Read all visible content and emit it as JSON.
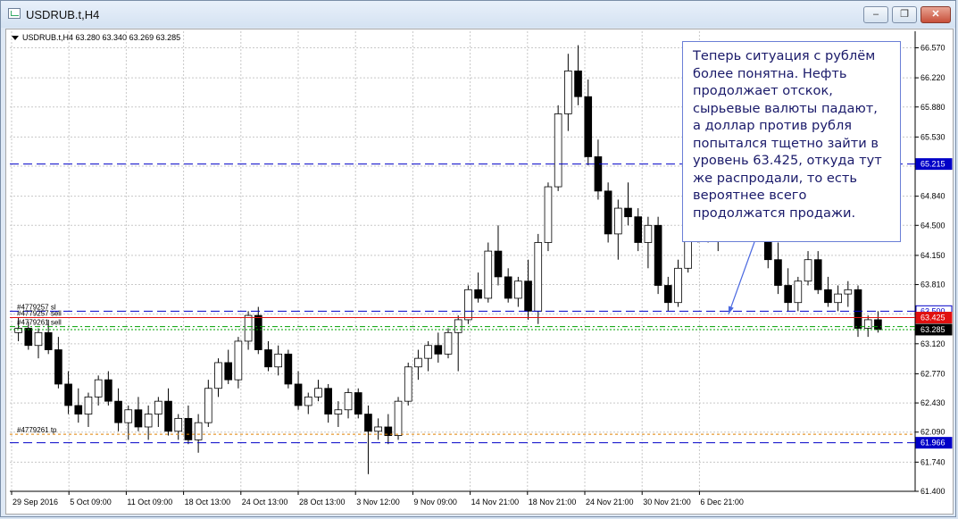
{
  "window": {
    "title": "USDRUB.t,H4",
    "minimize": "‒",
    "maximize": "❐",
    "close": "✕"
  },
  "chart_info": {
    "symbol_line": "USDRUB.t,H4  63.280 63.340 63.269 63.285"
  },
  "annotation": {
    "text": "Теперь ситуация с рублём\nболее понятна. Нефть\nпродолжает отскок,\nсырьевые валюты падают,\nа доллар против рубля\nпопытался тщетно зайти в\nуровень 63.425, откуда тут\nже распродали, то есть\nвероятнее всего\nпродолжатся продажи."
  },
  "colors": {
    "bull": "#ffffff",
    "bear": "#000000",
    "grid": "#c8c8c8",
    "blue_line": "#0000c8",
    "red_line": "#e01010",
    "green_line": "#00a000",
    "orange_line": "#e08000"
  },
  "chart_data": {
    "type": "candlestick",
    "title": "",
    "ylim": [
      61.4,
      66.7
    ],
    "y_ticks": [
      61.4,
      61.74,
      62.09,
      62.43,
      62.77,
      63.12,
      63.465,
      63.81,
      64.15,
      64.5,
      64.84,
      65.19,
      65.53,
      65.88,
      66.22,
      66.57
    ],
    "y_tick_labels": [
      "61.400",
      "61.740",
      "62.090",
      "62.430",
      "62.770",
      "63.120",
      "63.465",
      "63.810",
      "64.150",
      "64.500",
      "64.840",
      "65.190",
      "65.530",
      "65.880",
      "66.220",
      "66.570"
    ],
    "x_labels": [
      "29 Sep 2016",
      "5 Oct 09:00",
      "11 Oct 09:00",
      "18 Oct 13:00",
      "24 Oct 13:00",
      "28 Oct 13:00",
      "3 Nov 12:00",
      "9 Nov 09:00",
      "14 Nov 21:00",
      "18 Nov 21:00",
      "24 Nov 21:00",
      "30 Nov 21:00",
      "6 Dec 21:00"
    ],
    "current_price": 63.285,
    "price_labels": [
      {
        "value": 65.215,
        "text": "65.215",
        "color": "#0000c8",
        "style": "solid"
      },
      {
        "value": 63.5,
        "text": "63.500",
        "color": "#0000c8",
        "style": "outline"
      },
      {
        "value": 63.425,
        "text": "63.425",
        "color": "#e01010",
        "style": "solid"
      },
      {
        "value": 63.285,
        "text": "63.285",
        "color": "#000000",
        "style": "solid"
      },
      {
        "value": 61.966,
        "text": "61.966",
        "color": "#0000c8",
        "style": "solid"
      }
    ],
    "levels": [
      {
        "value": 65.215,
        "color": "#0000c8",
        "dash": "10,5",
        "label": ""
      },
      {
        "value": 63.5,
        "color": "#0000c8",
        "dash": "10,5",
        "label": "#4779257 sl"
      },
      {
        "value": 63.425,
        "color": "#e01010",
        "dash": "",
        "label": "#4779257 sell"
      },
      {
        "value": 63.32,
        "color": "#00a000",
        "dash": "6,3,2,3",
        "label": "#4779261 sell"
      },
      {
        "value": 63.285,
        "color": "#00a000",
        "dash": "2,2",
        "label": ""
      },
      {
        "value": 62.065,
        "color": "#e08000",
        "dash": "3,3",
        "label": "#4779261 tp"
      },
      {
        "value": 61.966,
        "color": "#0000c8",
        "dash": "10,5",
        "label": ""
      }
    ],
    "ohlc": [
      [
        63.25,
        63.42,
        63.15,
        63.3
      ],
      [
        63.3,
        63.38,
        63.05,
        63.1
      ],
      [
        63.1,
        63.3,
        62.95,
        63.25
      ],
      [
        63.25,
        63.4,
        63.0,
        63.05
      ],
      [
        63.05,
        63.2,
        62.6,
        62.65
      ],
      [
        62.65,
        62.8,
        62.3,
        62.4
      ],
      [
        62.4,
        62.6,
        62.2,
        62.3
      ],
      [
        62.3,
        62.55,
        62.15,
        62.5
      ],
      [
        62.5,
        62.75,
        62.4,
        62.7
      ],
      [
        62.7,
        62.8,
        62.4,
        62.45
      ],
      [
        62.45,
        62.6,
        62.1,
        62.2
      ],
      [
        62.2,
        62.4,
        62.0,
        62.35
      ],
      [
        62.35,
        62.5,
        62.1,
        62.15
      ],
      [
        62.15,
        62.4,
        62.0,
        62.3
      ],
      [
        62.3,
        62.5,
        62.15,
        62.45
      ],
      [
        62.45,
        62.6,
        62.05,
        62.1
      ],
      [
        62.1,
        62.3,
        62.0,
        62.25
      ],
      [
        62.25,
        62.4,
        61.95,
        62.0
      ],
      [
        62.0,
        62.3,
        61.85,
        62.2
      ],
      [
        62.2,
        62.7,
        62.15,
        62.6
      ],
      [
        62.6,
        62.95,
        62.5,
        62.9
      ],
      [
        62.9,
        63.05,
        62.65,
        62.7
      ],
      [
        62.7,
        63.2,
        62.6,
        63.15
      ],
      [
        63.15,
        63.5,
        63.05,
        63.45
      ],
      [
        63.45,
        63.55,
        63.0,
        63.05
      ],
      [
        63.05,
        63.15,
        62.8,
        62.85
      ],
      [
        62.85,
        63.1,
        62.75,
        63.0
      ],
      [
        63.0,
        63.05,
        62.6,
        62.65
      ],
      [
        62.65,
        62.8,
        62.35,
        62.4
      ],
      [
        62.4,
        62.55,
        62.3,
        62.5
      ],
      [
        62.5,
        62.7,
        62.45,
        62.6
      ],
      [
        62.6,
        62.65,
        62.2,
        62.3
      ],
      [
        62.3,
        62.45,
        62.15,
        62.35
      ],
      [
        62.35,
        62.6,
        62.25,
        62.55
      ],
      [
        62.55,
        62.6,
        62.25,
        62.3
      ],
      [
        62.3,
        62.4,
        61.6,
        62.1
      ],
      [
        62.1,
        62.25,
        62.0,
        62.15
      ],
      [
        62.15,
        62.3,
        61.95,
        62.05
      ],
      [
        62.05,
        62.5,
        62.0,
        62.45
      ],
      [
        62.45,
        62.9,
        62.4,
        62.85
      ],
      [
        62.85,
        63.05,
        62.7,
        62.95
      ],
      [
        62.95,
        63.15,
        62.8,
        63.1
      ],
      [
        63.1,
        63.25,
        62.9,
        63.0
      ],
      [
        63.0,
        63.3,
        62.95,
        63.25
      ],
      [
        63.25,
        63.45,
        62.8,
        63.4
      ],
      [
        63.4,
        63.8,
        63.35,
        63.75
      ],
      [
        63.75,
        63.95,
        63.6,
        63.65
      ],
      [
        63.65,
        64.3,
        63.6,
        64.2
      ],
      [
        64.2,
        64.5,
        63.8,
        63.9
      ],
      [
        63.9,
        64.0,
        63.6,
        63.65
      ],
      [
        63.65,
        63.9,
        63.55,
        63.85
      ],
      [
        63.85,
        64.1,
        63.4,
        63.5
      ],
      [
        63.5,
        64.4,
        63.35,
        64.3
      ],
      [
        64.3,
        65.0,
        64.2,
        64.95
      ],
      [
        64.95,
        65.9,
        64.9,
        65.8
      ],
      [
        65.8,
        66.5,
        65.6,
        66.3
      ],
      [
        66.3,
        66.6,
        65.9,
        66.0
      ],
      [
        66.0,
        66.2,
        65.2,
        65.3
      ],
      [
        65.3,
        65.5,
        64.8,
        64.9
      ],
      [
        64.9,
        65.0,
        64.3,
        64.4
      ],
      [
        64.4,
        64.8,
        64.1,
        64.7
      ],
      [
        64.7,
        65.0,
        64.5,
        64.6
      ],
      [
        64.6,
        64.7,
        64.2,
        64.3
      ],
      [
        64.3,
        64.6,
        64.0,
        64.5
      ],
      [
        64.5,
        64.6,
        63.7,
        63.8
      ],
      [
        63.8,
        63.9,
        63.5,
        63.6
      ],
      [
        63.6,
        64.1,
        63.55,
        64.0
      ],
      [
        64.0,
        64.6,
        63.95,
        64.5
      ],
      [
        64.5,
        64.9,
        64.3,
        64.8
      ],
      [
        64.8,
        64.9,
        64.3,
        64.4
      ],
      [
        64.4,
        64.6,
        64.2,
        64.5
      ],
      [
        64.5,
        64.9,
        64.4,
        64.85
      ],
      [
        64.85,
        65.3,
        64.8,
        65.2
      ],
      [
        65.2,
        65.55,
        65.0,
        65.1
      ],
      [
        65.1,
        65.2,
        64.6,
        64.7
      ],
      [
        64.7,
        64.8,
        64.0,
        64.1
      ],
      [
        64.1,
        64.3,
        63.7,
        63.8
      ],
      [
        63.8,
        64.0,
        63.5,
        63.6
      ],
      [
        63.6,
        63.9,
        63.5,
        63.85
      ],
      [
        63.85,
        64.2,
        63.8,
        64.1
      ],
      [
        64.1,
        64.2,
        63.7,
        63.75
      ],
      [
        63.75,
        63.9,
        63.55,
        63.6
      ],
      [
        63.6,
        63.8,
        63.5,
        63.7
      ],
      [
        63.7,
        63.85,
        63.55,
        63.75
      ],
      [
        63.75,
        63.8,
        63.2,
        63.3
      ],
      [
        63.3,
        63.45,
        63.2,
        63.4
      ],
      [
        63.4,
        63.5,
        63.25,
        63.285
      ]
    ]
  }
}
